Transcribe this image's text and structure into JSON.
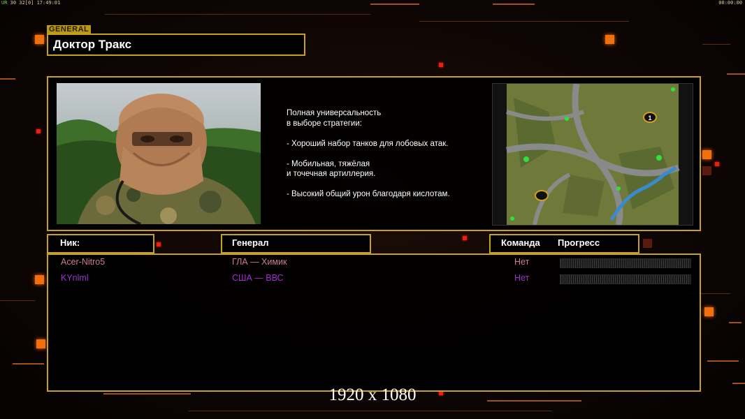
{
  "topbar": {
    "left_prefix": "UR",
    "left_stats": "30 32[0] 17:49:01",
    "right_time": "00:00:00"
  },
  "general": {
    "tag": "GENERAL",
    "name": "Доктор Тракс",
    "description": "Полная универсальность\nв выборе стратегии:\n\n- Хороший набор танков для лобовых атак.\n\n- Мобильная, тяжёлая\nи точечная артиллерия.\n\n- Высокий общий урон благодаря кислотам."
  },
  "minimap": {
    "markers": [
      "1"
    ]
  },
  "headers": {
    "nick": "Ник:",
    "general": "Генерал",
    "team": "Команда",
    "progress": "Прогресс"
  },
  "players": [
    {
      "nick": "Acer-Nitro5",
      "general": "ГЛА — Химик",
      "team": "Нет",
      "color": "#d07a9a",
      "progress": 0
    },
    {
      "nick": "KYnlml",
      "general": "США — ВВС",
      "team": "Нет",
      "color": "#a030d0",
      "progress": 0
    }
  ],
  "resolution": "1920 x 1080",
  "colors": {
    "accent": "#c9a21c",
    "orange": "#f07010"
  }
}
